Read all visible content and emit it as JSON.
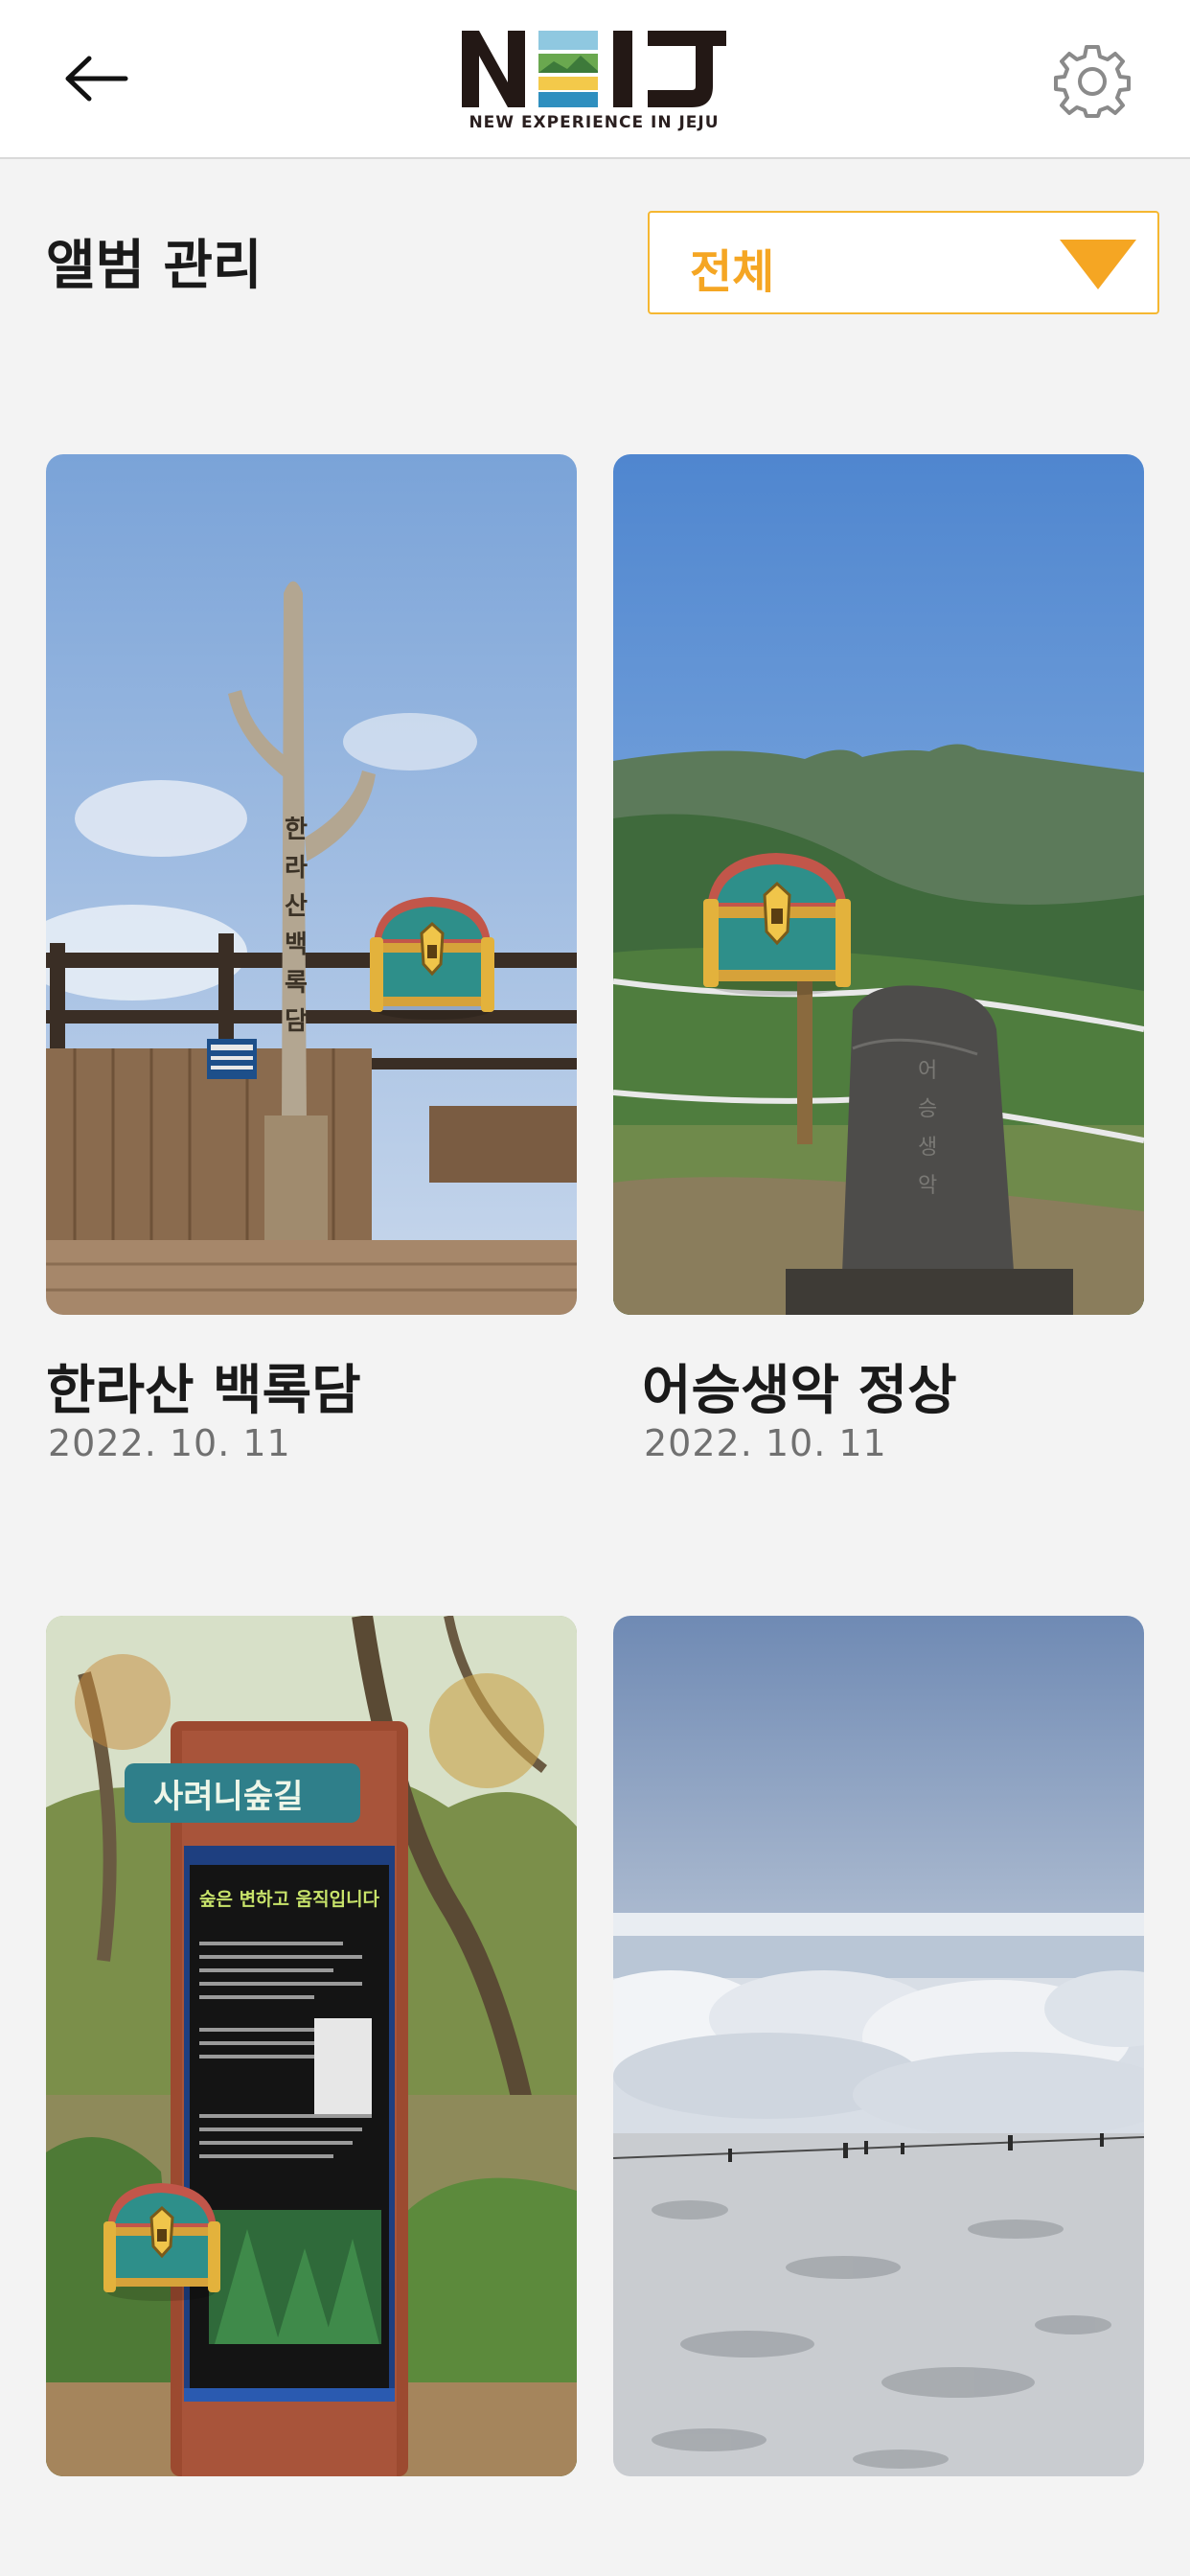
{
  "header": {
    "back_icon": "arrow-left-icon",
    "logo_text": "NEIJ",
    "logo_tagline": "NEW EXPERIENCE IN JEJU",
    "settings_icon": "gear-icon"
  },
  "page": {
    "title": "앨범 관리"
  },
  "filter": {
    "selected": "전체",
    "arrow_icon": "triangle-down-icon",
    "accent_color": "#f5a623"
  },
  "albums": [
    {
      "title": "한라산 백록담",
      "date": "2022. 10. 11",
      "has_treasure": true
    },
    {
      "title": "어승생악 정상",
      "date": "2022. 10. 11",
      "has_treasure": true
    },
    {
      "title": "",
      "date": "",
      "has_treasure": true,
      "sign_text": "사려니숲길",
      "sign_headline": "숲은 변하고 움직입니다"
    },
    {
      "title": "",
      "date": "",
      "has_treasure": false
    }
  ]
}
